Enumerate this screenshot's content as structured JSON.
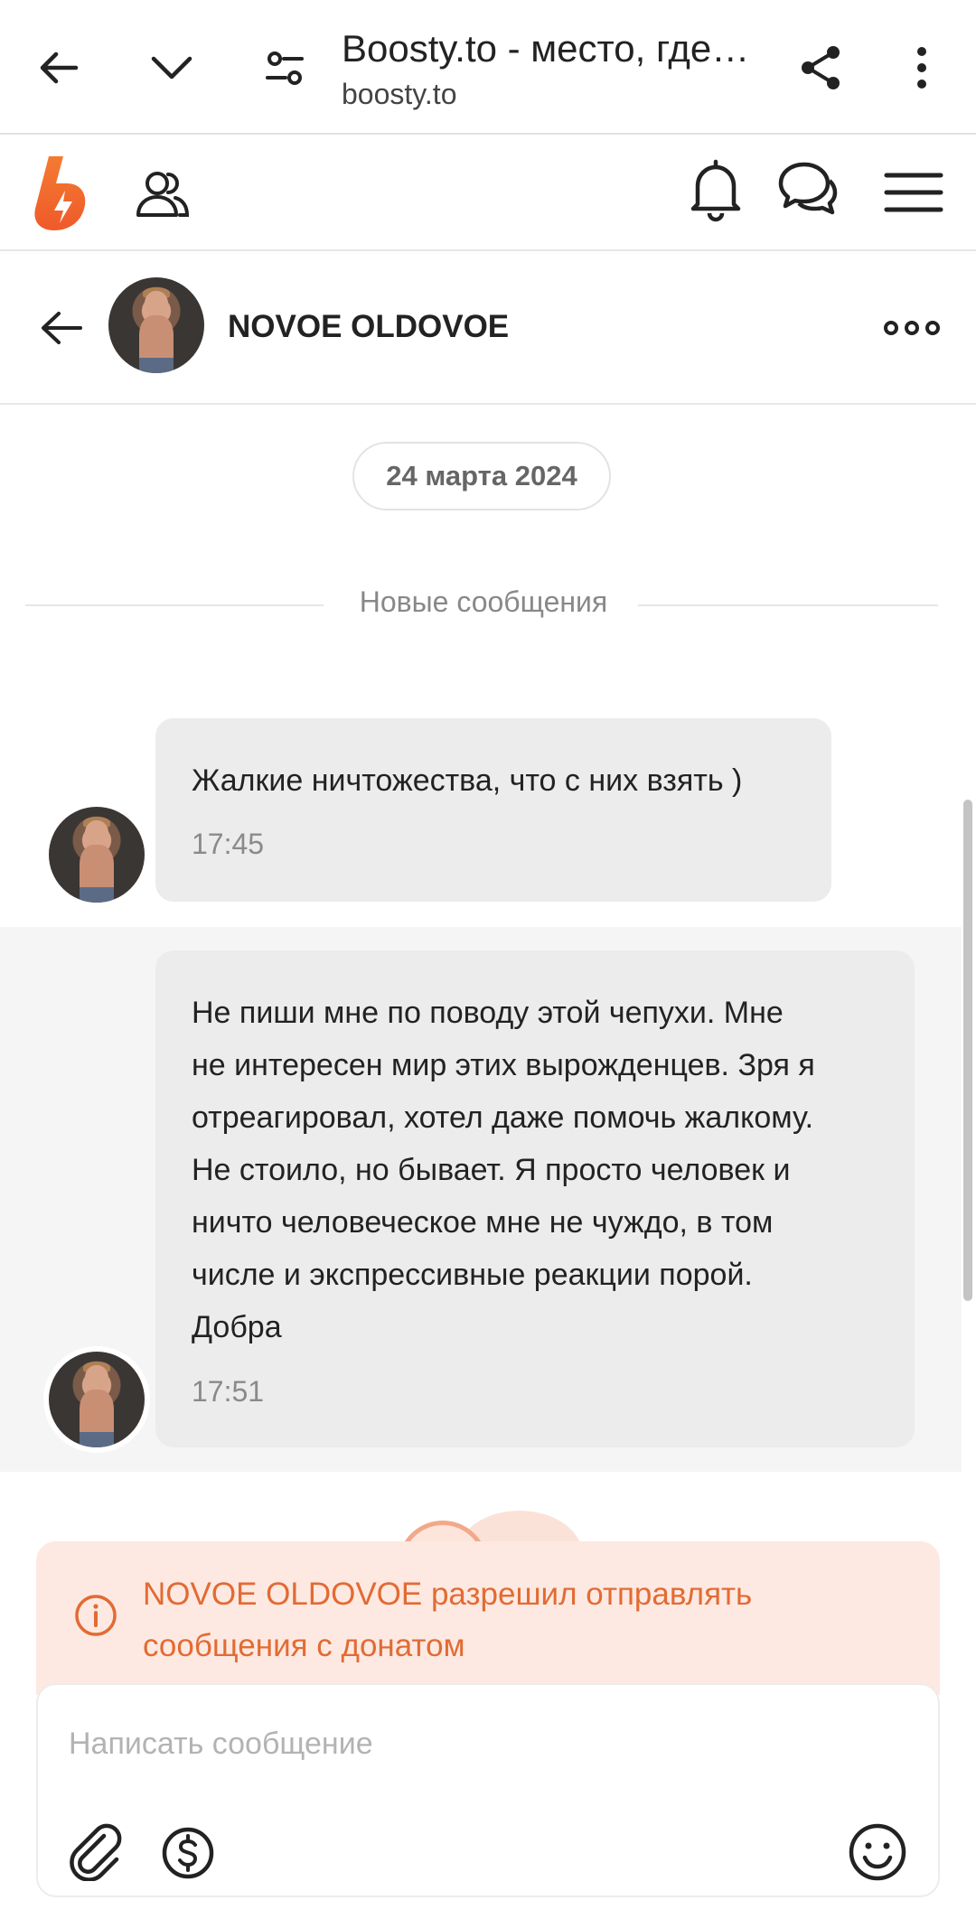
{
  "browser": {
    "title": "Boosty.to - место, где …",
    "url": "boosty.to"
  },
  "chat_header": {
    "name": "NOVOE OLDOVOE"
  },
  "chat": {
    "date": "24 марта 2024",
    "new_messages_label": "Новые сообщения",
    "messages": [
      {
        "text": "Жалкие ничтожества, что с них взять )",
        "time": "17:45"
      },
      {
        "text": "Не пиши мне по поводу этой чепухи. Мне\nне интересен мир этих вырожденцев. Зря я\nотреагировал, хотел даже помочь жалкому.\nНе стоило, но бывает. Я просто человек и\nничто человеческое мне не чуждо, в том\nчисле и экспрессивные реакции порой.\nДобра",
        "time": "17:51"
      }
    ]
  },
  "notice": {
    "text": "NOVOE OLDOVOE разрешил отправлять сообщения с донатом"
  },
  "composer": {
    "placeholder": "Написать сообщение"
  },
  "icons": {
    "back": "arrow-left-icon",
    "collapse": "chevron-down-icon",
    "site_settings": "tune-icon",
    "share": "share-icon",
    "more": "more-vertical-icon",
    "logo": "boosty-logo",
    "subscriptions": "people-icon",
    "notifications": "bell-icon",
    "messages": "chat-bubbles-icon",
    "menu": "hamburger-icon",
    "chat_more": "more-horizontal-icon",
    "info": "info-icon",
    "attach": "paperclip-icon",
    "donate": "dollar-circle-icon",
    "emoji": "smiley-icon"
  },
  "colors": {
    "accent": "#F15F2C",
    "notice_bg": "#FDE9E1",
    "notice_text": "#E26B34",
    "bubble_bg": "#ECECEC"
  }
}
